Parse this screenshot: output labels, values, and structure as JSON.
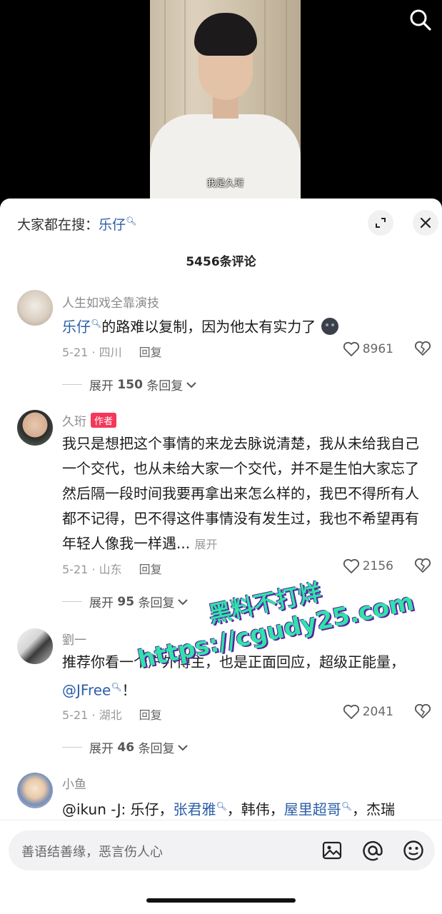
{
  "video": {
    "subtitle": "我是久珩",
    "search_icon": "search-icon"
  },
  "panel": {
    "trend_prefix": "大家都在搜：",
    "trend_keyword": "乐仔",
    "comment_count": "5456条评论"
  },
  "comments": [
    {
      "name": "人生如戏全靠演技",
      "text_link": "乐仔",
      "text_rest": "的路难以复制，因为他太有实力了",
      "date_loc": "5-21 · 四川",
      "reply_label": "回复",
      "likes": "8961",
      "more_replies": {
        "prefix": "展开",
        "count": "150",
        "suffix": "条回复"
      }
    },
    {
      "name": "久珩",
      "author_tag": "作者",
      "text": "我只是想把这个事情的来龙去脉说清楚，我从未给我自己一个交代，也从未给大家一个交代，并不是生怕大家忘了然后隔一段时间我要再拿出来怎么样的，我巴不得所有人都不记得，巴不得这件事情没有发生过，我也不希望再有年轻人像我一样遇...",
      "expand_label": "展开",
      "date_loc": "5-21 · 山东",
      "reply_label": "回复",
      "likes": "2156",
      "more_replies": {
        "prefix": "展开",
        "count": "95",
        "suffix": "条回复"
      }
    },
    {
      "name": "劉一",
      "text": "推荐你看一个户外博主，也是正面回应，超级正能量，",
      "mention": "@JFree",
      "mention_end": "！",
      "date_loc": "5-21 · 湖北",
      "reply_label": "回复",
      "likes": "2041",
      "more_replies": {
        "prefix": "展开",
        "count": "46",
        "suffix": "条回复"
      }
    },
    {
      "name": "小鱼",
      "text_a": "@ikun -J: 乐仔，",
      "link_b": "张君雅",
      "text_c": "，韩伟，",
      "link_d": "屋里超哥",
      "text_e": "，杰瑞"
    }
  ],
  "watermark": {
    "line1": "黑料不打烊",
    "line2": "https://cgudy25.com"
  },
  "input": {
    "placeholder": "善语结善缘，恶言伤人心"
  },
  "colors": {
    "link": "#2a5ea8",
    "author_tag": "#f4375a",
    "watermark": "#2fe3a9"
  }
}
